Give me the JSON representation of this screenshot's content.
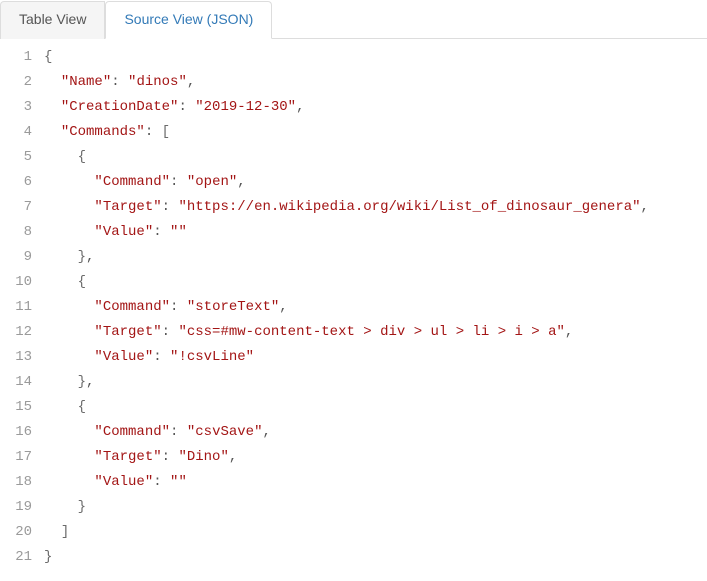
{
  "tabs": {
    "table_view": "Table View",
    "source_view": "Source View (JSON)"
  },
  "code_lines": [
    {
      "n": 1,
      "seg": [
        [
          "p",
          "{"
        ]
      ]
    },
    {
      "n": 2,
      "seg": [
        [
          "c",
          "  "
        ],
        [
          "k",
          "\"Name\""
        ],
        [
          "c",
          ": "
        ],
        [
          "s",
          "\"dinos\""
        ],
        [
          "c",
          ","
        ]
      ]
    },
    {
      "n": 3,
      "seg": [
        [
          "c",
          "  "
        ],
        [
          "k",
          "\"CreationDate\""
        ],
        [
          "c",
          ": "
        ],
        [
          "s",
          "\"2019-12-30\""
        ],
        [
          "c",
          ","
        ]
      ]
    },
    {
      "n": 4,
      "seg": [
        [
          "c",
          "  "
        ],
        [
          "k",
          "\"Commands\""
        ],
        [
          "c",
          ": "
        ],
        [
          "p",
          "["
        ]
      ]
    },
    {
      "n": 5,
      "seg": [
        [
          "c",
          "    "
        ],
        [
          "p",
          "{"
        ]
      ]
    },
    {
      "n": 6,
      "seg": [
        [
          "c",
          "      "
        ],
        [
          "k",
          "\"Command\""
        ],
        [
          "c",
          ": "
        ],
        [
          "s",
          "\"open\""
        ],
        [
          "c",
          ","
        ]
      ]
    },
    {
      "n": 7,
      "seg": [
        [
          "c",
          "      "
        ],
        [
          "k",
          "\"Target\""
        ],
        [
          "c",
          ": "
        ],
        [
          "s",
          "\"https://en.wikipedia.org/wiki/List_of_dinosaur_genera\""
        ],
        [
          "c",
          ","
        ]
      ]
    },
    {
      "n": 8,
      "seg": [
        [
          "c",
          "      "
        ],
        [
          "k",
          "\"Value\""
        ],
        [
          "c",
          ": "
        ],
        [
          "s",
          "\"\""
        ]
      ]
    },
    {
      "n": 9,
      "seg": [
        [
          "c",
          "    "
        ],
        [
          "p",
          "}"
        ],
        [
          "c",
          ","
        ]
      ]
    },
    {
      "n": 10,
      "seg": [
        [
          "c",
          "    "
        ],
        [
          "p",
          "{"
        ]
      ]
    },
    {
      "n": 11,
      "seg": [
        [
          "c",
          "      "
        ],
        [
          "k",
          "\"Command\""
        ],
        [
          "c",
          ": "
        ],
        [
          "s",
          "\"storeText\""
        ],
        [
          "c",
          ","
        ]
      ]
    },
    {
      "n": 12,
      "seg": [
        [
          "c",
          "      "
        ],
        [
          "k",
          "\"Target\""
        ],
        [
          "c",
          ": "
        ],
        [
          "s",
          "\"css=#mw-content-text > div > ul > li > i > a\""
        ],
        [
          "c",
          ","
        ]
      ]
    },
    {
      "n": 13,
      "seg": [
        [
          "c",
          "      "
        ],
        [
          "k",
          "\"Value\""
        ],
        [
          "c",
          ": "
        ],
        [
          "s",
          "\"!csvLine\""
        ]
      ]
    },
    {
      "n": 14,
      "seg": [
        [
          "c",
          "    "
        ],
        [
          "p",
          "}"
        ],
        [
          "c",
          ","
        ]
      ]
    },
    {
      "n": 15,
      "seg": [
        [
          "c",
          "    "
        ],
        [
          "p",
          "{"
        ]
      ]
    },
    {
      "n": 16,
      "seg": [
        [
          "c",
          "      "
        ],
        [
          "k",
          "\"Command\""
        ],
        [
          "c",
          ": "
        ],
        [
          "s",
          "\"csvSave\""
        ],
        [
          "c",
          ","
        ]
      ]
    },
    {
      "n": 17,
      "seg": [
        [
          "c",
          "      "
        ],
        [
          "k",
          "\"Target\""
        ],
        [
          "c",
          ": "
        ],
        [
          "s",
          "\"Dino\""
        ],
        [
          "c",
          ","
        ]
      ]
    },
    {
      "n": 18,
      "seg": [
        [
          "c",
          "      "
        ],
        [
          "k",
          "\"Value\""
        ],
        [
          "c",
          ": "
        ],
        [
          "s",
          "\"\""
        ]
      ]
    },
    {
      "n": 19,
      "seg": [
        [
          "c",
          "    "
        ],
        [
          "p",
          "}"
        ]
      ]
    },
    {
      "n": 20,
      "seg": [
        [
          "c",
          "  "
        ],
        [
          "p",
          "]"
        ]
      ]
    },
    {
      "n": 21,
      "seg": [
        [
          "p",
          "}"
        ]
      ]
    }
  ]
}
